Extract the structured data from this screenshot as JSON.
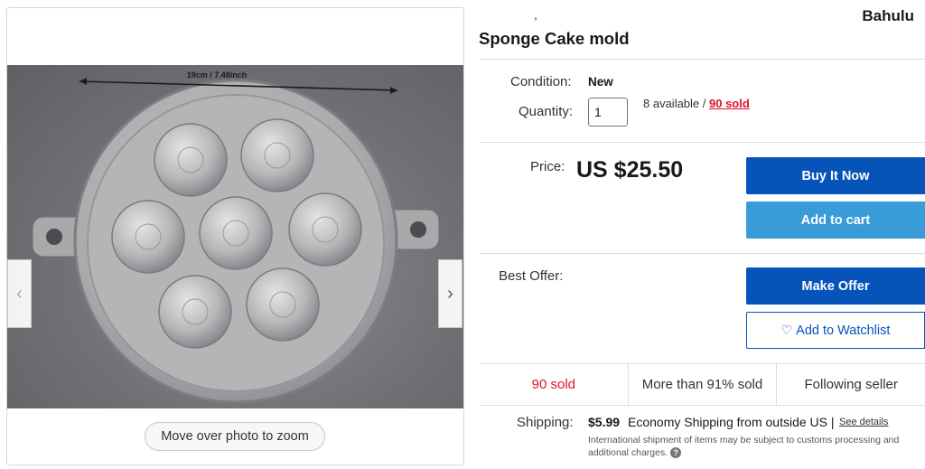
{
  "title": {
    "top_right": "Bahulu",
    "partial_line": ",",
    "main": "Sponge Cake mold"
  },
  "gallery": {
    "photo_caption": "19cm / 7.48inch",
    "prev_arrow": "‹",
    "next_arrow": "›",
    "zoom_hint": "Move over photo to zoom"
  },
  "details": {
    "condition_label": "Condition:",
    "condition_value": "New",
    "quantity_label": "Quantity:",
    "quantity_value": "1",
    "available_text": "8 available / ",
    "sold_link": "90 sold",
    "price_label": "Price:",
    "price_value": "US $25.50",
    "best_offer_label": "Best Offer:"
  },
  "buttons": {
    "buy_now": "Buy It Now",
    "add_to_cart": "Add to cart",
    "make_offer": "Make Offer",
    "watchlist_icon": "♡",
    "add_to_watchlist": "Add to Watchlist"
  },
  "stats": {
    "sold": "90 sold",
    "percent_sold": "More than 91% sold",
    "following": "Following seller"
  },
  "shipping": {
    "label": "Shipping:",
    "price": "$5.99",
    "method": "Economy Shipping from outside US |",
    "details_link": "See details",
    "note": "International shipment of items may be subject to customs processing and additional charges.",
    "help_icon": "?"
  },
  "colors": {
    "primary_blue": "#0654ba",
    "light_blue": "#3a9bd9",
    "sold_red": "#e0102b"
  }
}
